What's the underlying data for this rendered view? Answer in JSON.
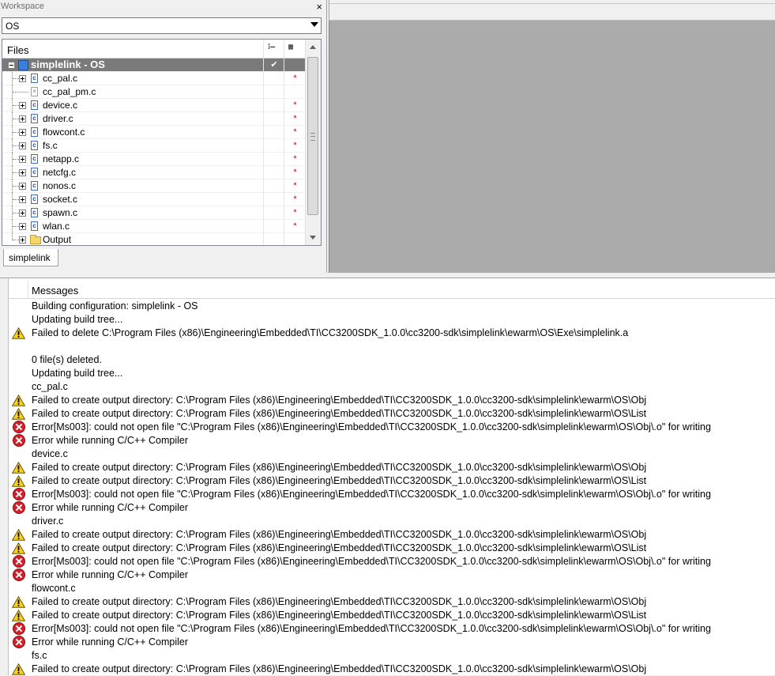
{
  "workspace": {
    "title": "Workspace",
    "close_glyph": "×",
    "config_selected": "OS",
    "files_header": "Files",
    "col1_icon": "check-toggle-icon",
    "col2_icon": "options-icon",
    "col1_glyph": "⁝–",
    "col2_glyph": "▦",
    "root": {
      "label": "simplelink - OS",
      "check": "✔"
    },
    "files": [
      {
        "name": "cc_pal.c",
        "mark": "*",
        "expandable": true,
        "excluded": false
      },
      {
        "name": "cc_pal_pm.c",
        "mark": "",
        "expandable": false,
        "excluded": true
      },
      {
        "name": "device.c",
        "mark": "*",
        "expandable": true,
        "excluded": false
      },
      {
        "name": "driver.c",
        "mark": "*",
        "expandable": true,
        "excluded": false
      },
      {
        "name": "flowcont.c",
        "mark": "*",
        "expandable": true,
        "excluded": false
      },
      {
        "name": "fs.c",
        "mark": "*",
        "expandable": true,
        "excluded": false
      },
      {
        "name": "netapp.c",
        "mark": "*",
        "expandable": true,
        "excluded": false
      },
      {
        "name": "netcfg.c",
        "mark": "*",
        "expandable": true,
        "excluded": false
      },
      {
        "name": "nonos.c",
        "mark": "*",
        "expandable": true,
        "excluded": false
      },
      {
        "name": "socket.c",
        "mark": "*",
        "expandable": true,
        "excluded": false
      },
      {
        "name": "spawn.c",
        "mark": "*",
        "expandable": true,
        "excluded": false
      },
      {
        "name": "wlan.c",
        "mark": "*",
        "expandable": true,
        "excluded": false
      }
    ],
    "output_folder": "Output",
    "tab_label": "simplelink"
  },
  "messages": {
    "header": "Messages",
    "rows": [
      {
        "type": "info",
        "text": "Building configuration: simplelink - OS"
      },
      {
        "type": "info",
        "text": "Updating build tree..."
      },
      {
        "type": "warning",
        "text": "Failed to delete C:\\Program Files (x86)\\Engineering\\Embedded\\TI\\CC3200SDK_1.0.0\\cc3200-sdk\\simplelink\\ewarm\\OS\\Exe\\simplelink.a"
      },
      {
        "type": "info",
        "text": ""
      },
      {
        "type": "info",
        "text": "0  file(s) deleted."
      },
      {
        "type": "info",
        "text": "Updating build tree..."
      },
      {
        "type": "info",
        "text": "cc_pal.c"
      },
      {
        "type": "warning",
        "text": "Failed to create output directory: C:\\Program Files (x86)\\Engineering\\Embedded\\TI\\CC3200SDK_1.0.0\\cc3200-sdk\\simplelink\\ewarm\\OS\\Obj"
      },
      {
        "type": "warning",
        "text": "Failed to create output directory: C:\\Program Files (x86)\\Engineering\\Embedded\\TI\\CC3200SDK_1.0.0\\cc3200-sdk\\simplelink\\ewarm\\OS\\List"
      },
      {
        "type": "error",
        "text": "Error[Ms003]: could not open file \"C:\\Program Files (x86)\\Engineering\\Embedded\\TI\\CC3200SDK_1.0.0\\cc3200-sdk\\simplelink\\ewarm\\OS\\Obj\\.o\" for writing"
      },
      {
        "type": "error",
        "text": "Error while running C/C++ Compiler"
      },
      {
        "type": "info",
        "text": "device.c"
      },
      {
        "type": "warning",
        "text": "Failed to create output directory: C:\\Program Files (x86)\\Engineering\\Embedded\\TI\\CC3200SDK_1.0.0\\cc3200-sdk\\simplelink\\ewarm\\OS\\Obj"
      },
      {
        "type": "warning",
        "text": "Failed to create output directory: C:\\Program Files (x86)\\Engineering\\Embedded\\TI\\CC3200SDK_1.0.0\\cc3200-sdk\\simplelink\\ewarm\\OS\\List"
      },
      {
        "type": "error",
        "text": "Error[Ms003]: could not open file \"C:\\Program Files (x86)\\Engineering\\Embedded\\TI\\CC3200SDK_1.0.0\\cc3200-sdk\\simplelink\\ewarm\\OS\\Obj\\.o\" for writing"
      },
      {
        "type": "error",
        "text": "Error while running C/C++ Compiler"
      },
      {
        "type": "info",
        "text": "driver.c"
      },
      {
        "type": "warning",
        "text": "Failed to create output directory: C:\\Program Files (x86)\\Engineering\\Embedded\\TI\\CC3200SDK_1.0.0\\cc3200-sdk\\simplelink\\ewarm\\OS\\Obj"
      },
      {
        "type": "warning",
        "text": "Failed to create output directory: C:\\Program Files (x86)\\Engineering\\Embedded\\TI\\CC3200SDK_1.0.0\\cc3200-sdk\\simplelink\\ewarm\\OS\\List"
      },
      {
        "type": "error",
        "text": "Error[Ms003]: could not open file \"C:\\Program Files (x86)\\Engineering\\Embedded\\TI\\CC3200SDK_1.0.0\\cc3200-sdk\\simplelink\\ewarm\\OS\\Obj\\.o\" for writing"
      },
      {
        "type": "error",
        "text": "Error while running C/C++ Compiler"
      },
      {
        "type": "info",
        "text": "flowcont.c"
      },
      {
        "type": "warning",
        "text": "Failed to create output directory: C:\\Program Files (x86)\\Engineering\\Embedded\\TI\\CC3200SDK_1.0.0\\cc3200-sdk\\simplelink\\ewarm\\OS\\Obj"
      },
      {
        "type": "warning",
        "text": "Failed to create output directory: C:\\Program Files (x86)\\Engineering\\Embedded\\TI\\CC3200SDK_1.0.0\\cc3200-sdk\\simplelink\\ewarm\\OS\\List"
      },
      {
        "type": "error",
        "text": "Error[Ms003]: could not open file \"C:\\Program Files (x86)\\Engineering\\Embedded\\TI\\CC3200SDK_1.0.0\\cc3200-sdk\\simplelink\\ewarm\\OS\\Obj\\.o\" for writing"
      },
      {
        "type": "error",
        "text": "Error while running C/C++ Compiler"
      },
      {
        "type": "info",
        "text": "fs.c"
      },
      {
        "type": "warning",
        "text": "Failed to create output directory: C:\\Program Files (x86)\\Engineering\\Embedded\\TI\\CC3200SDK_1.0.0\\cc3200-sdk\\simplelink\\ewarm\\OS\\Obj"
      }
    ]
  },
  "colors": {
    "editor_bg": "#ababab",
    "root_row_bg": "#7a7a7a",
    "mark_red": "#d00000",
    "error_red": "#d4202a",
    "warning_yellow": "#f7d11c"
  }
}
